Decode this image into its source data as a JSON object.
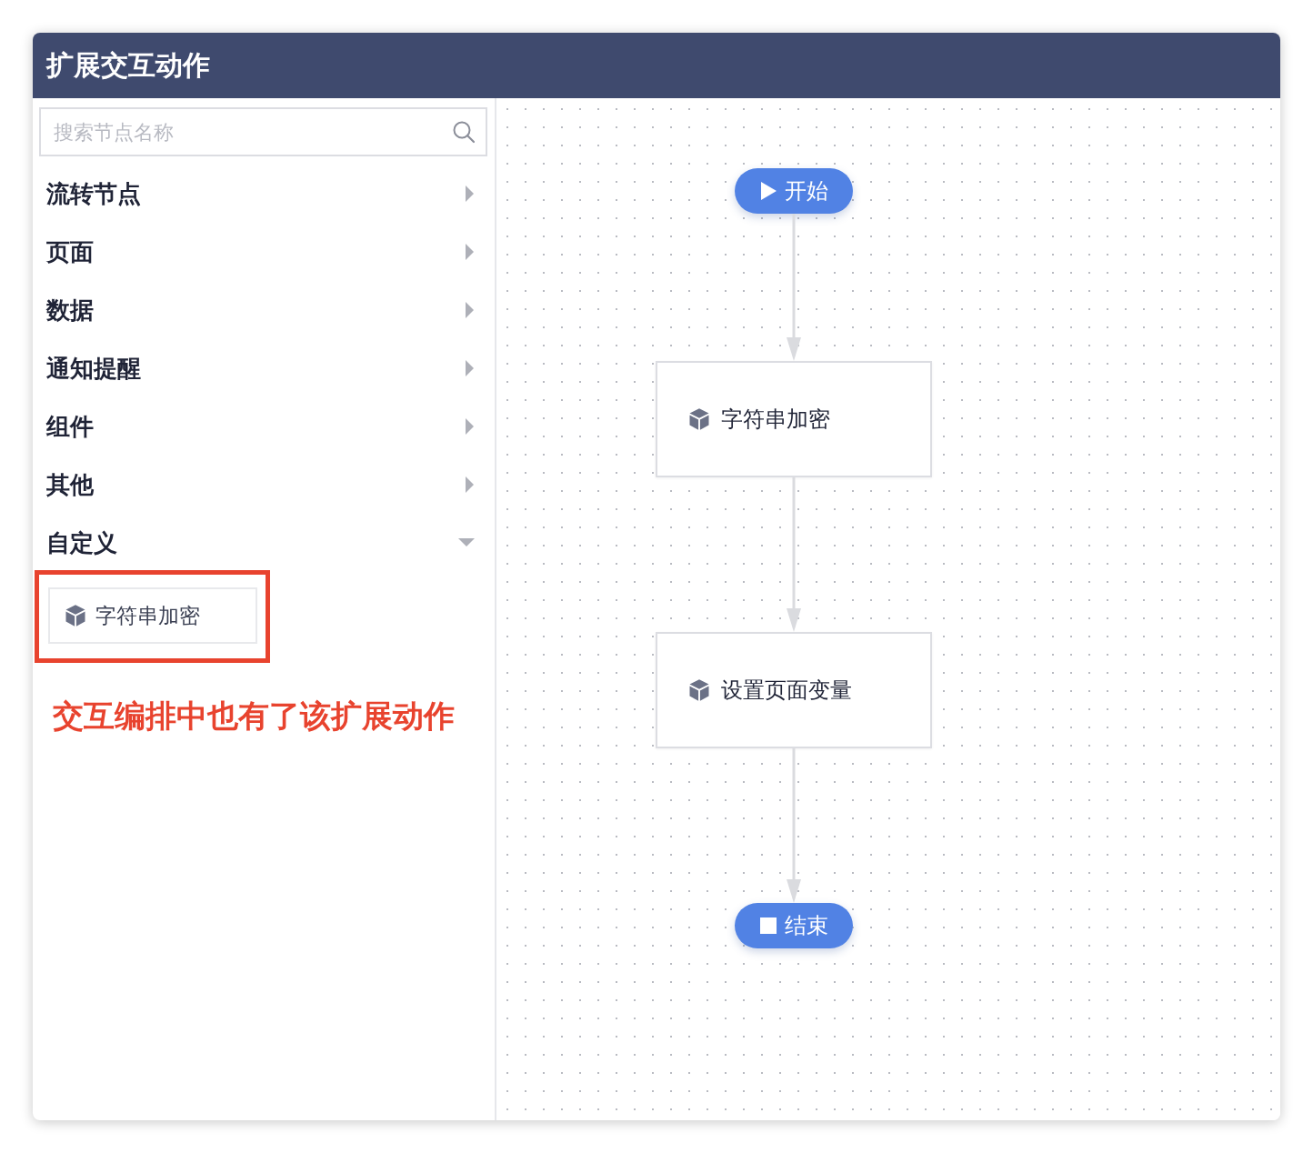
{
  "window": {
    "title": "扩展交互动作"
  },
  "search": {
    "placeholder": "搜索节点名称"
  },
  "categories": [
    {
      "label": "流转节点",
      "expanded": false
    },
    {
      "label": "页面",
      "expanded": false
    },
    {
      "label": "数据",
      "expanded": false
    },
    {
      "label": "通知提醒",
      "expanded": false
    },
    {
      "label": "组件",
      "expanded": false
    },
    {
      "label": "其他",
      "expanded": false
    },
    {
      "label": "自定义",
      "expanded": true,
      "children": [
        {
          "label": "字符串加密"
        }
      ]
    }
  ],
  "annotation": {
    "text": "交互编排中也有了该扩展动作"
  },
  "flow": {
    "nodes": [
      {
        "kind": "start",
        "label": "开始"
      },
      {
        "kind": "action",
        "label": "字符串加密"
      },
      {
        "kind": "action",
        "label": "设置页面变量"
      },
      {
        "kind": "end",
        "label": "结束"
      }
    ]
  }
}
